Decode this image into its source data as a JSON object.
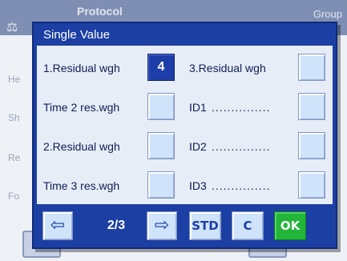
{
  "background": {
    "header_title": "Protocol",
    "header_extra": "Group",
    "side_items": [
      "He",
      "Sh",
      "Re",
      "Fo"
    ]
  },
  "dialog": {
    "title": "Single Value",
    "rows_left": [
      {
        "label": "1.Residual wgh",
        "value": "4",
        "active": true
      },
      {
        "label": "Time 2 res.wgh",
        "value": ""
      },
      {
        "label": "2.Residual wgh",
        "value": ""
      },
      {
        "label": "Time 3 res.wgh",
        "value": ""
      }
    ],
    "rows_right": [
      {
        "label": "3.Residual wgh",
        "dots": ""
      },
      {
        "label": "ID1",
        "dots": "..............."
      },
      {
        "label": "ID2",
        "dots": "..............."
      },
      {
        "label": "ID3",
        "dots": "..............."
      }
    ]
  },
  "footer": {
    "page_indicator": "2/3",
    "prev_icon": "arrow-left-icon",
    "next_icon": "arrow-right-icon",
    "std_label": "STD",
    "c_label": "C",
    "ok_label": "OK"
  },
  "colors": {
    "dialog_bg": "#1c3fa3",
    "ok_green": "#21b53a",
    "cell_bg": "#cfe3fa"
  }
}
